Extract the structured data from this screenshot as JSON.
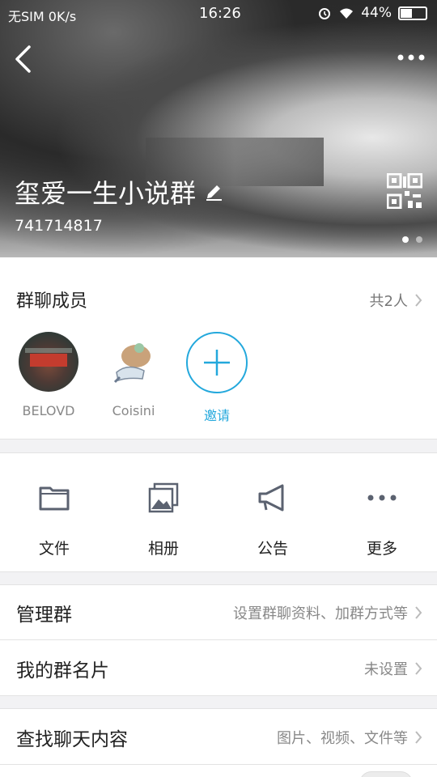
{
  "status_bar": {
    "carrier": "无SIM 0K/s",
    "time": "16:26",
    "battery": "44%",
    "battery_level": 0.44
  },
  "header": {
    "group_name": "玺爱一生小说群",
    "group_id": "741714817"
  },
  "members": {
    "title": "群聊成员",
    "count": "共2人",
    "list": [
      {
        "name": "BELOVD"
      },
      {
        "name": "Coisini"
      }
    ],
    "invite_label": "邀请"
  },
  "actions": [
    {
      "label": "文件",
      "icon": "folder-icon"
    },
    {
      "label": "相册",
      "icon": "album-icon"
    },
    {
      "label": "公告",
      "icon": "megaphone-icon"
    },
    {
      "label": "更多",
      "icon": "more-icon"
    }
  ],
  "rows": {
    "manage": {
      "label": "管理群",
      "value": "设置群聊资料、加群方式等"
    },
    "card": {
      "label": "我的群名片",
      "value": "未设置"
    },
    "search": {
      "label": "查找聊天内容",
      "value": "图片、视频、文件等"
    }
  },
  "colors": {
    "accent": "#23a8dc",
    "icon_gray": "#5b6270"
  }
}
